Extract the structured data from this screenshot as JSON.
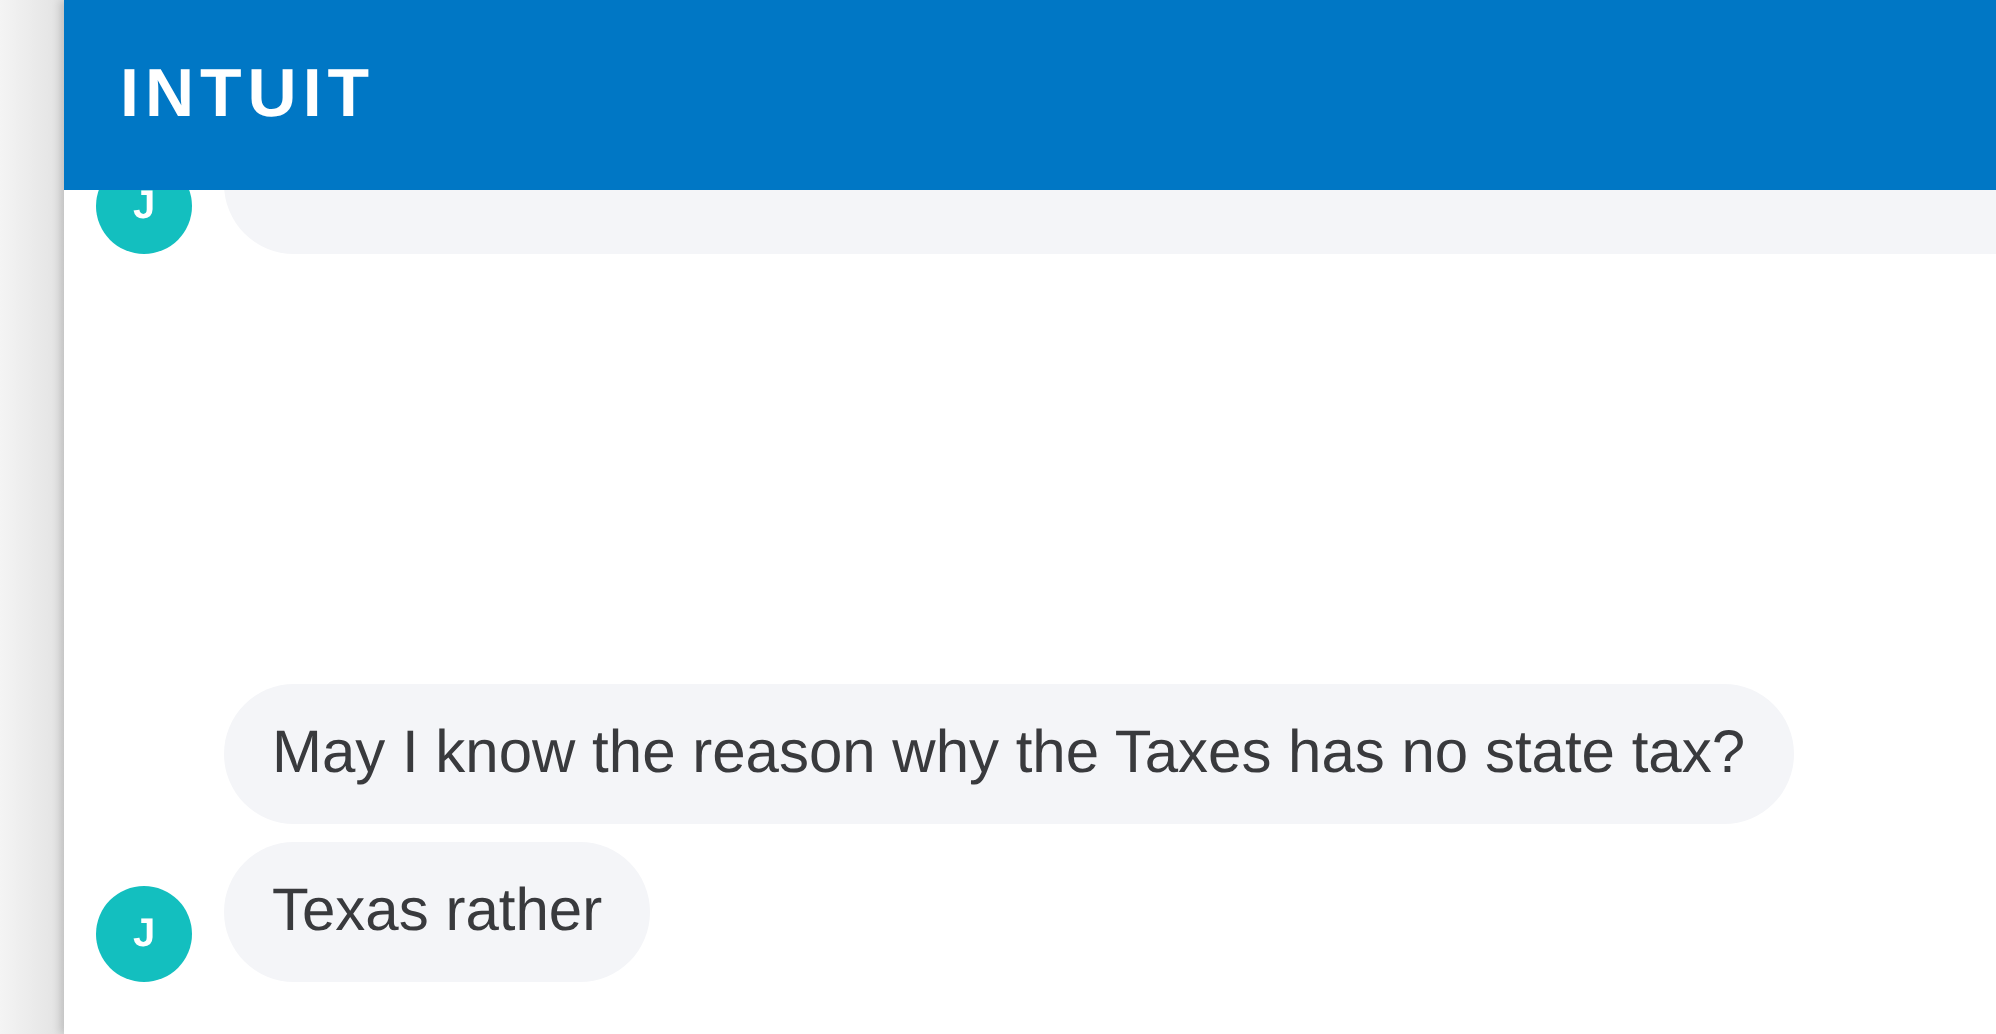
{
  "header": {
    "logo": "INTUIT"
  },
  "messages": [
    {
      "kind": "clipped",
      "avatar": "J"
    },
    {
      "kind": "full",
      "text": "May I know the reason why the Taxes has no state tax?"
    },
    {
      "kind": "full",
      "avatar": "J",
      "text": "Texas rather"
    }
  ]
}
